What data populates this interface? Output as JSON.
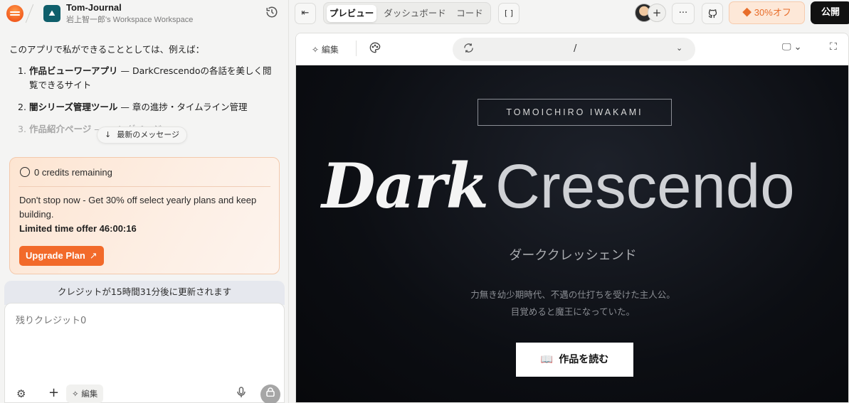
{
  "project": {
    "name": "Tom-Journal",
    "workspace": "岩上智一郎's Workspace Workspace"
  },
  "chat": {
    "intro": "このアプリで私ができることとしては、例えば：",
    "items": [
      {
        "num": "1.",
        "title": "作品ビューワーアプリ",
        "desc": " — DarkCrescendoの各話を美しく閲覧できるサイト"
      },
      {
        "num": "2.",
        "title": "闇シリーズ管理ツール",
        "desc": " — 章の進捗・タイムライン管理"
      },
      {
        "num": "3.",
        "title": "作品紹介ページ",
        "desc": " — … ングページ"
      }
    ],
    "latest_message_label": "最新のメッセージ"
  },
  "credits": {
    "remaining": "0 credits remaining",
    "message": "Don't stop now - Get 30% off select yearly plans and keep building.",
    "offer": "Limited time offer 46:00:16",
    "upgrade_label": "Upgrade Plan"
  },
  "refresh_notice": "クレジットが15時間31分後に更新されます",
  "composer": {
    "placeholder": "残りクレジット0",
    "edit_label": "編集"
  },
  "topbar": {
    "tabs": [
      "プレビュー",
      "ダッシュボード",
      "コード"
    ],
    "active_tab": "プレビュー",
    "discount_label": "30%オフ",
    "publish_label": "公開"
  },
  "preview_toolbar": {
    "edit_label": "編集",
    "url": "/"
  },
  "site": {
    "badge": "TOMOICHIRO IWAKAMI",
    "title_part1": "Dark",
    "title_part2": "Crescendo",
    "subtitle": "ダーククレッシェンド",
    "desc_line1": "力無き幼少期時代、不遇の仕打ちを受けた主人公。",
    "desc_line2": "目覚めると魔王になっていた。",
    "read_button": "作品を読む"
  },
  "colors": {
    "accent": "#f26a2a",
    "site_bg": "#0c0e13",
    "discount_bg": "#fde8d8"
  }
}
